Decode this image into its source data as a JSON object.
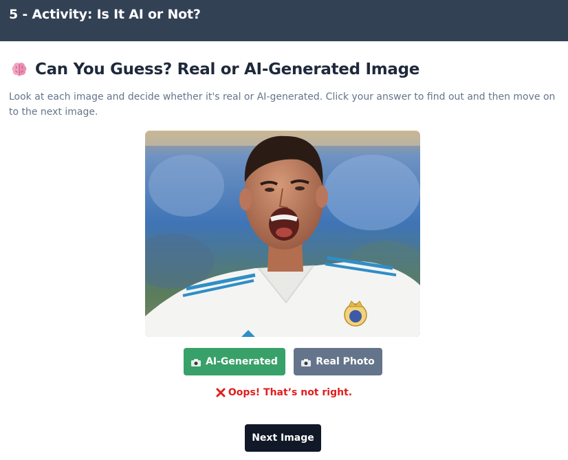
{
  "header": {
    "title": "5 - Activity: Is It AI or Not?"
  },
  "activity": {
    "heading": "Can You Guess? Real or AI-Generated Image",
    "heading_icon": "brain-icon",
    "intro": "Look at each image and decide whether it's real or AI-generated. Click your answer to find out and then move on to the next image."
  },
  "image": {
    "subject": "football-player-photo"
  },
  "buttons": {
    "ai_label": "AI-Generated",
    "real_label": "Real Photo",
    "icon": "camera-icon",
    "next_label": "Next Image"
  },
  "feedback": {
    "icon": "cross-mark-icon",
    "text": "Oops! That’s not right."
  },
  "colors": {
    "header_bg": "#334155",
    "ai_button": "#38a169",
    "real_button": "#64748b",
    "next_button": "#111827",
    "feedback_text": "#e11d1d"
  }
}
